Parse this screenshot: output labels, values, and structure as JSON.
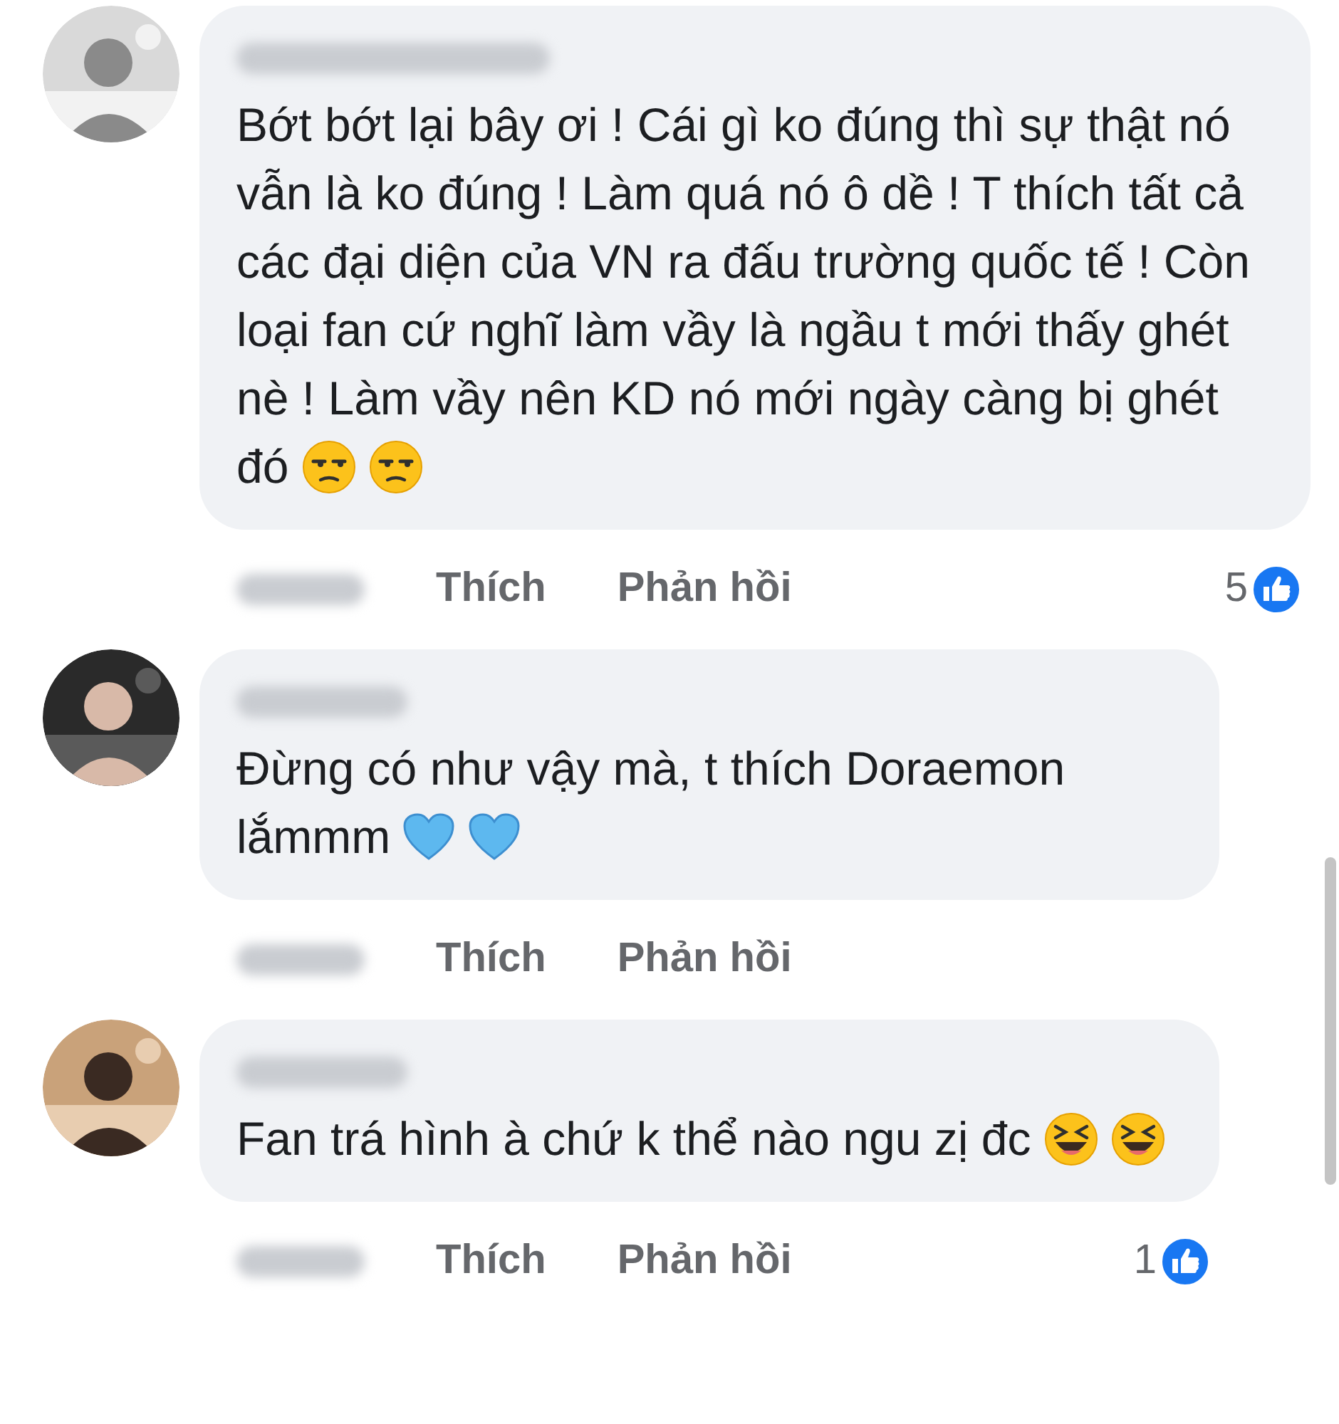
{
  "comments": [
    {
      "text": "Bớt bớt lại bây ơi ! Cái gì ko đúng thì sự thật nó vẫn là ko đúng ! Làm quá nó ô dề ! T thích tất cả các đại diện của VN ra đấu trường quốc tế ! Còn loại fan cứ nghĩ làm vầy là ngầu t mới thấy ghét nè ! Làm vầy nên KD nó mới ngày càng bị ghét đó",
      "emojis": [
        {
          "kind": "unamused"
        },
        {
          "kind": "unamused"
        }
      ],
      "like": "Thích",
      "reply": "Phản hồi",
      "reactions": "5"
    },
    {
      "text": "Đừng có như vậy mà, t thích Doraemon lắmmm",
      "emojis": [
        {
          "kind": "blue-heart"
        },
        {
          "kind": "blue-heart"
        }
      ],
      "like": "Thích",
      "reply": "Phản hồi"
    },
    {
      "text": "Fan trá hình à chứ k thể nào ngu zị đc",
      "emojis": [
        {
          "kind": "laughing"
        },
        {
          "kind": "laughing"
        }
      ],
      "like": "Thích",
      "reply": "Phản hồi",
      "reactions": "1"
    }
  ]
}
